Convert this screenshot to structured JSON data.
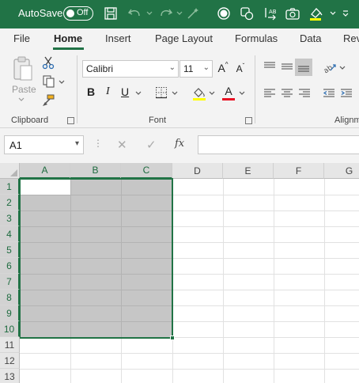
{
  "titlebar": {
    "autosave_label": "AutoSave",
    "autosave_state": "Off",
    "color": "#217346",
    "icons": [
      "save-icon",
      "undo-icon",
      "redo-icon",
      "magic-wand-icon",
      "circle-icon",
      "shapes-icon",
      "text-direction-icon",
      "camera-icon",
      "highlighter-icon",
      "customize-quick-access-icon"
    ]
  },
  "menu": {
    "tabs": [
      "File",
      "Home",
      "Insert",
      "Page Layout",
      "Formulas",
      "Data",
      "Rev"
    ],
    "active_tab": "Home"
  },
  "ribbon": {
    "clipboard": {
      "label": "Clipboard",
      "paste_label": "Paste"
    },
    "font": {
      "label": "Font",
      "font_name": "Calibri",
      "font_size": "11",
      "bold": "B",
      "italic": "I",
      "underline": "U",
      "grow_font": "A",
      "shrink_font": "A",
      "font_color_letter": "A",
      "highlight_color": "#ffff00",
      "font_color": "#e81123"
    },
    "alignment": {
      "label": "Alignm"
    }
  },
  "formula_bar": {
    "cell_reference": "A1",
    "fx_label": "fx",
    "formula_value": ""
  },
  "grid": {
    "columns": [
      "A",
      "B",
      "C",
      "D",
      "E",
      "F",
      "G"
    ],
    "selected_columns": [
      "A",
      "B",
      "C"
    ],
    "rows": [
      "1",
      "2",
      "3",
      "4",
      "5",
      "6",
      "7",
      "8",
      "9",
      "10",
      "11",
      "12",
      "13"
    ],
    "selected_rows": [
      "1",
      "2",
      "3",
      "4",
      "5",
      "6",
      "7",
      "8",
      "9",
      "10"
    ],
    "selection_range": "A1:C10",
    "accent": "#217346",
    "selection_fill": "#c6c6c6"
  }
}
